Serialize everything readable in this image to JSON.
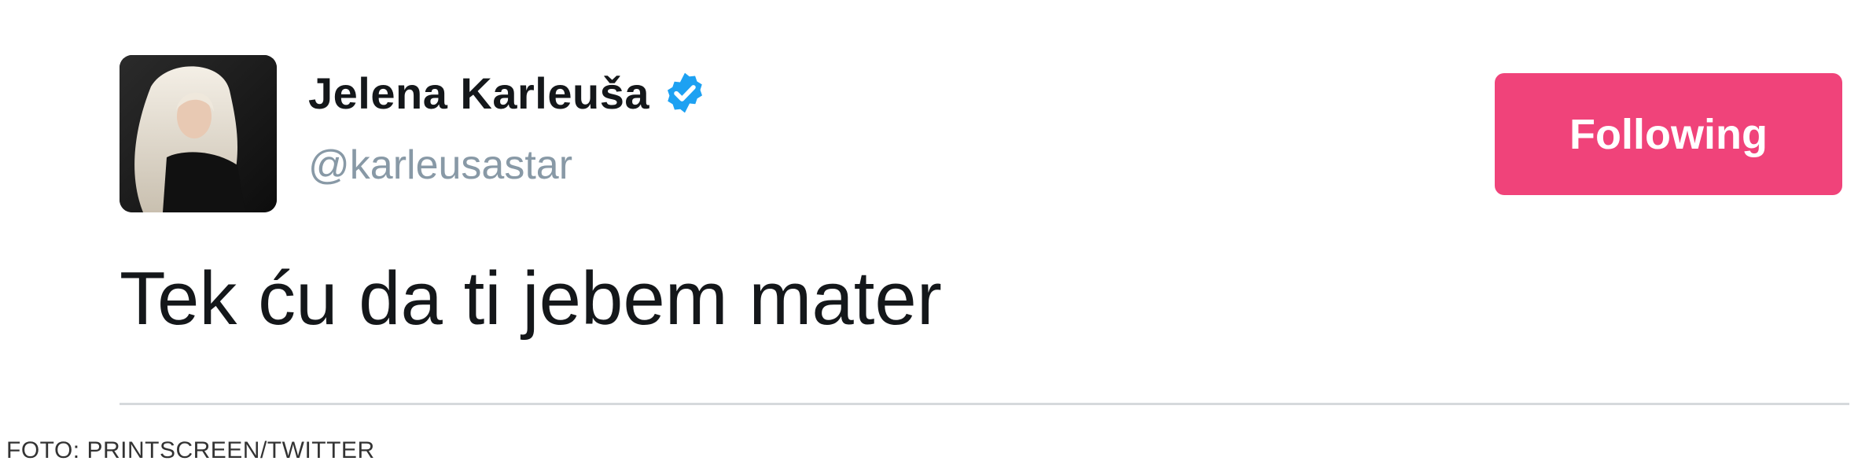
{
  "tweet": {
    "display_name": "Jelena Karleuša",
    "handle": "@karleusastar",
    "text": "Tek ću da ti jebem mater",
    "verified_icon": "verified-check-icon",
    "verified_color": "#1da1f2"
  },
  "follow_button": {
    "label": "Following",
    "color": "#f0437a"
  },
  "credit": "FOTO: PRINTSCREEN/TWITTER"
}
